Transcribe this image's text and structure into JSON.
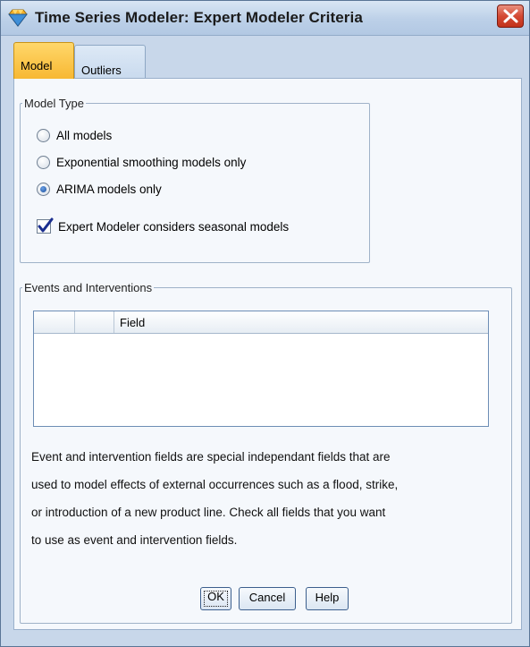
{
  "window": {
    "title": "Time Series Modeler: Expert Modeler Criteria",
    "icon": "diamond-app-icon",
    "close_icon": "close-x-icon"
  },
  "tabs": [
    {
      "label": "Model",
      "active": true
    },
    {
      "label": "Outliers",
      "active": false
    }
  ],
  "model_type": {
    "legend": "Model Type",
    "options": [
      {
        "label": "All models",
        "checked": false
      },
      {
        "label": "Exponential smoothing models only",
        "checked": false
      },
      {
        "label": "ARIMA models only",
        "checked": true
      }
    ],
    "seasonal_checkbox": {
      "label": "Expert Modeler considers seasonal models",
      "checked": true
    }
  },
  "events": {
    "legend": "Events and Interventions",
    "table": {
      "columns": [
        "",
        "",
        "Field"
      ],
      "rows": []
    },
    "description_lines": [
      "Event and intervention fields are special independant fields that are",
      "used to model effects of external occurrences such as a flood, strike,",
      "or introduction of a new product line. Check all fields that you want",
      "to use as event and intervention fields."
    ]
  },
  "buttons": {
    "ok": "OK",
    "cancel": "Cancel",
    "help": "Help"
  },
  "colors": {
    "active_tab": "#f7b833",
    "close_button": "#d44a34",
    "window_frame": "#c8d7ea"
  }
}
